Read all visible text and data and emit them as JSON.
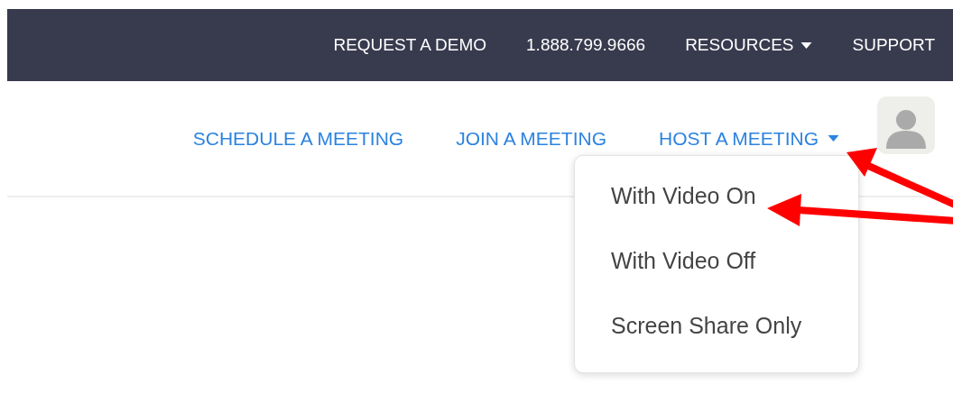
{
  "top_bar": {
    "items": [
      {
        "label": "REQUEST A DEMO",
        "kind": "link"
      },
      {
        "label": "1.888.799.9666",
        "kind": "link"
      },
      {
        "label": "RESOURCES",
        "kind": "dropdown"
      },
      {
        "label": "SUPPORT",
        "kind": "link"
      }
    ]
  },
  "nav": {
    "items": [
      {
        "label": "SCHEDULE A MEETING",
        "kind": "link"
      },
      {
        "label": "JOIN A MEETING",
        "kind": "link"
      },
      {
        "label": "HOST A MEETING",
        "kind": "dropdown",
        "menu": [
          "With Video On",
          "With Video Off",
          "Screen Share Only"
        ]
      }
    ]
  }
}
